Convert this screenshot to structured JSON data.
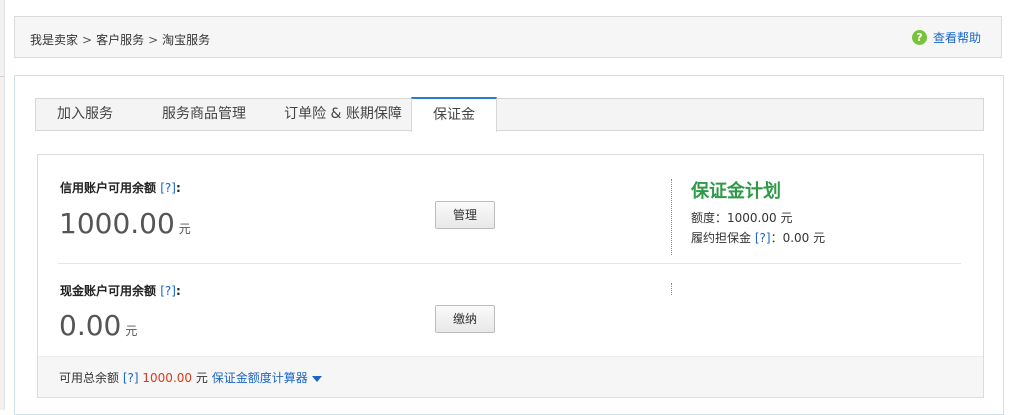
{
  "breadcrumb": {
    "items": [
      "我是卖家",
      "客户服务",
      "淘宝服务"
    ],
    "separator": ">"
  },
  "help": {
    "icon": "question-circle-icon",
    "label": "查看帮助",
    "icon_color": "#79c23b"
  },
  "tabs": [
    {
      "label": "加入服务",
      "active": false
    },
    {
      "label": "服务商品管理",
      "active": false
    },
    {
      "label": "订单险 & 账期保障",
      "active": false
    },
    {
      "label": "保证金",
      "active": true
    }
  ],
  "credit": {
    "label": "信用账户可用余额",
    "help": "[?]",
    "colon": ":",
    "amount": "1000.00",
    "unit": "元",
    "button": "管理"
  },
  "cash": {
    "label": "现金账户可用余额",
    "help": "[?]",
    "colon": ":",
    "amount": "0.00",
    "unit": "元",
    "button": "缴纳"
  },
  "plan": {
    "logo": "保证金计划",
    "quota_label": "额度：",
    "quota_value": "1000.00 元",
    "deposit_label": "履约担保金",
    "deposit_help": "[?]",
    "deposit_value": "：0.00 元"
  },
  "footer": {
    "label": "可用总余额",
    "help": "[?]",
    "amount": "1000.00",
    "unit": "元",
    "calculator": "保证金额度计算器"
  },
  "colors": {
    "accent": "#1a66c8",
    "tab_active_border": "#2b7bd1",
    "amount_red": "#d93b1c",
    "plan_green": "#2e9a48"
  }
}
